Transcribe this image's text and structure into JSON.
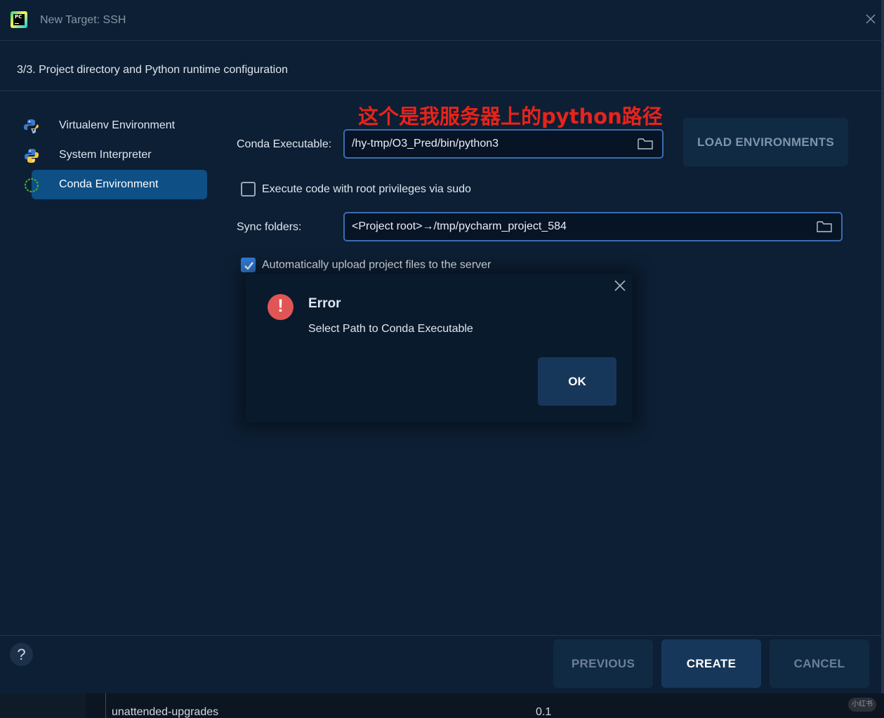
{
  "window": {
    "title": "New Target: SSH",
    "app_icon_text": "PC"
  },
  "step": {
    "text": "3/3. Project directory and Python runtime configuration"
  },
  "sidebar": {
    "items": [
      {
        "label": "Virtualenv Environment",
        "icon": "virtualenv-python-icon"
      },
      {
        "label": "System Interpreter",
        "icon": "python-icon"
      },
      {
        "label": "Conda Environment",
        "icon": "conda-icon",
        "selected": true
      }
    ]
  },
  "annotation": {
    "text": "这个是我服务器上的python路径",
    "color": "#e8231b"
  },
  "form": {
    "conda_label": "Conda Executable:",
    "conda_value": "/hy-tmp/O3_Pred/bin/python3",
    "load_button": "LOAD ENVIRONMENTS",
    "sudo_label": "Execute code with root privileges via sudo",
    "sudo_checked": false,
    "sync_label": "Sync folders:",
    "sync_value": "<Project root>→/tmp/pycharm_project_584",
    "upload_label": "Automatically upload project files to the server",
    "upload_checked": true
  },
  "error_popup": {
    "title": "Error",
    "message": "Select Path to Conda Executable",
    "ok_label": "OK",
    "icon_color": "#e05655"
  },
  "footer": {
    "help_label": "?",
    "previous_label": "PREVIOUS",
    "create_label": "CREATE",
    "cancel_label": "CANCEL"
  },
  "background": {
    "package_name": "unattended-upgrades",
    "package_version": "0.1",
    "watermark": "小红书"
  },
  "colors": {
    "accent": "#2f7bd8",
    "selected_bg": "#0e4f86",
    "dialog_bg": "#0d1f34"
  }
}
